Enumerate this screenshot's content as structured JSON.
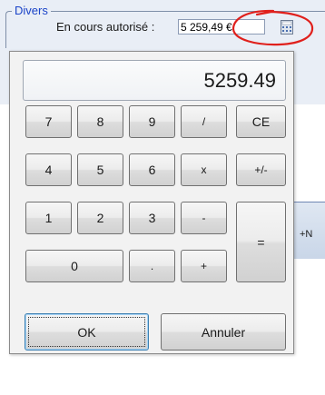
{
  "group": {
    "title": "Divers"
  },
  "field": {
    "label": "En cours autorisé :",
    "value": "5 259,49 €",
    "icon": "calculator-icon"
  },
  "annotation": {
    "color": "#e0201c"
  },
  "background_strip": {
    "label": "+N"
  },
  "calculator": {
    "display": "5259.49",
    "keys": {
      "k7": "7",
      "k8": "8",
      "k9": "9",
      "div": "/",
      "ce": "CE",
      "k4": "4",
      "k5": "5",
      "k6": "6",
      "mul": "x",
      "sign": "+/-",
      "k1": "1",
      "k2": "2",
      "k3": "3",
      "sub": "-",
      "eq": "=",
      "k0": "0",
      "dot": ".",
      "add": "+"
    },
    "ok_label": "OK",
    "cancel_label": "Annuler"
  },
  "colors": {
    "accent": "#1b44c8",
    "popup_bg": "#f2f2f2",
    "panel_bg": "#e9eef6"
  }
}
